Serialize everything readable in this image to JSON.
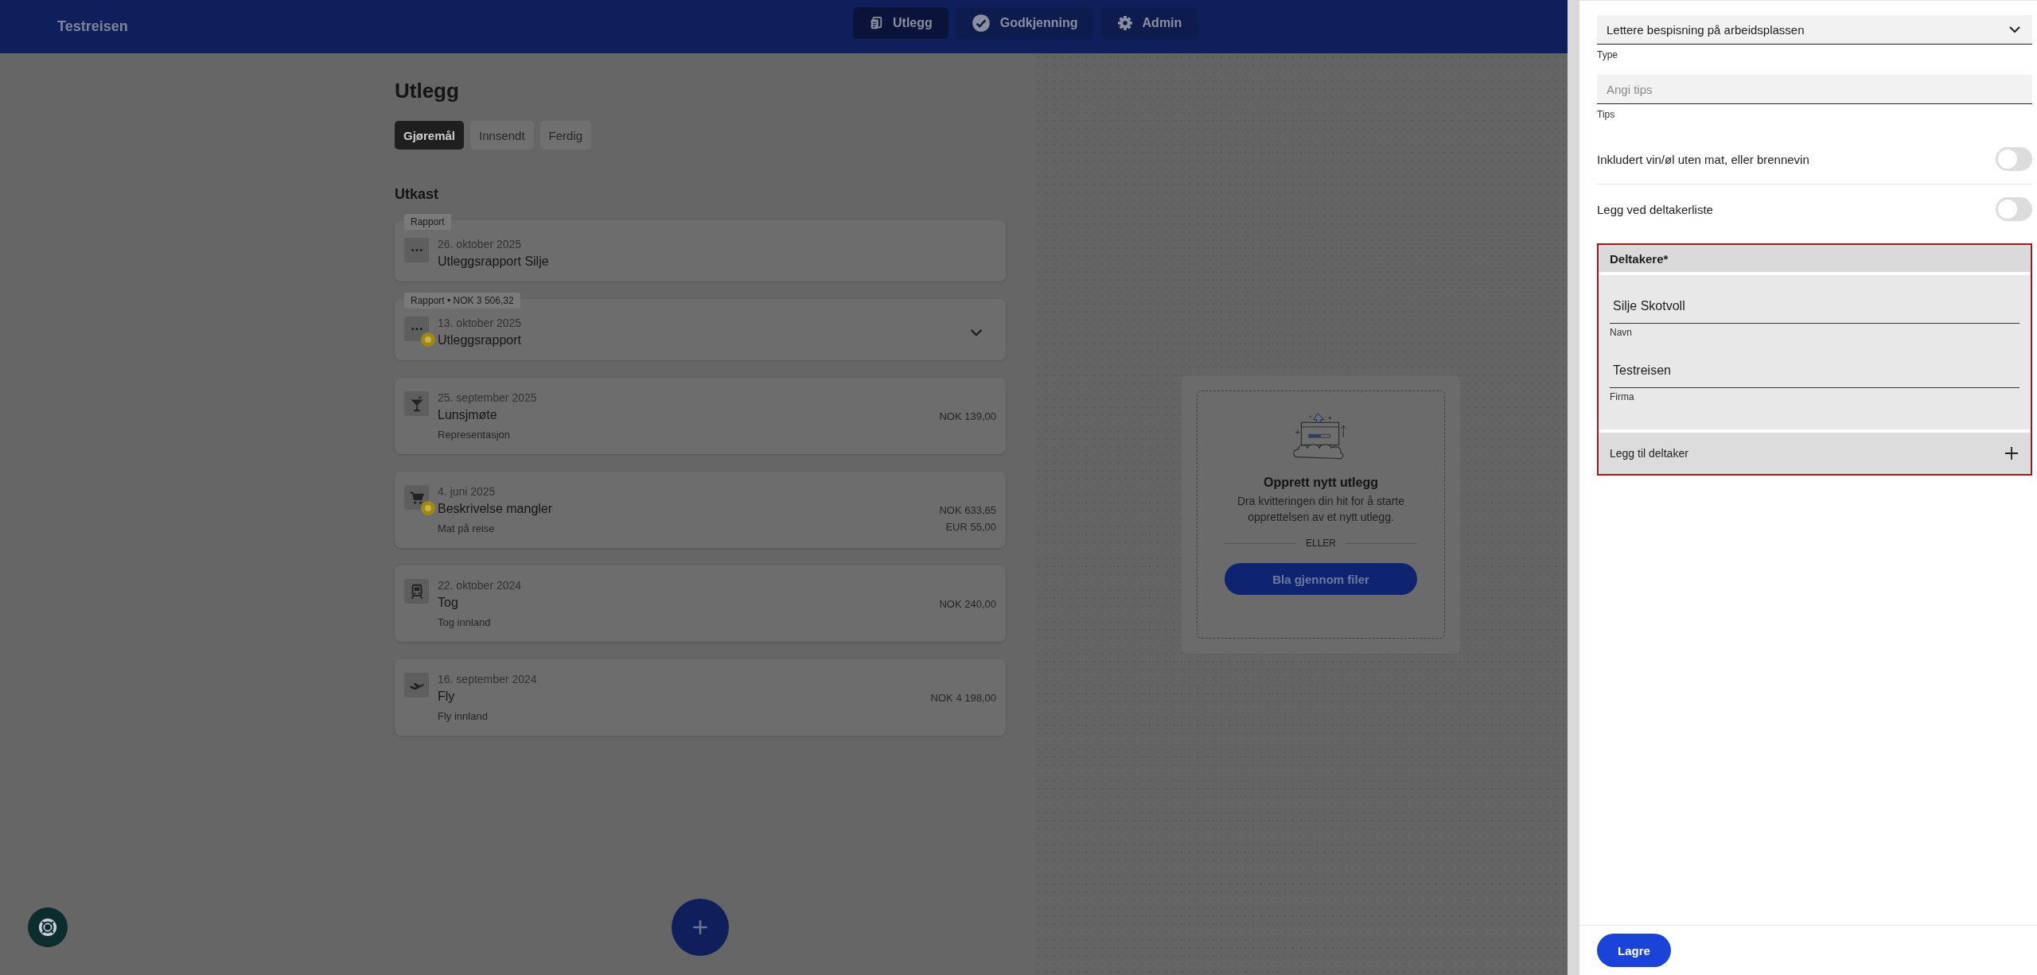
{
  "header": {
    "brand": "Testreisen",
    "nav": [
      {
        "label": "Utlegg",
        "selected": true
      },
      {
        "label": "Godkjenning",
        "selected": false
      },
      {
        "label": "Admin",
        "selected": false
      }
    ]
  },
  "page": {
    "title": "Utlegg",
    "tabs": [
      {
        "label": "Gjøremål",
        "selected": true
      },
      {
        "label": "Innsendt",
        "selected": false
      },
      {
        "label": "Ferdig",
        "selected": false
      }
    ],
    "section_title": "Utkast",
    "items": [
      {
        "kind": "report",
        "tag": "Rapport",
        "warning": false,
        "expandable": false,
        "date": "26. oktober 2025",
        "title": "Utleggsrapport Silje"
      },
      {
        "kind": "report",
        "tag": "Rapport • NOK 3 506,32",
        "warning": true,
        "expandable": true,
        "date": "13. oktober 2025",
        "title": "Utleggsrapport"
      },
      {
        "kind": "expense",
        "warning": false,
        "expandable": false,
        "date": "25. september 2025",
        "title": "Lunsjmøte",
        "subtitle": "Representasjon",
        "amounts": [
          "NOK 139,00"
        ]
      },
      {
        "kind": "expense",
        "warning": true,
        "expandable": false,
        "date": "4. juni 2025",
        "title": "Beskrivelse mangler",
        "subtitle": "Mat på reise",
        "amounts": [
          "NOK 633,65",
          "EUR 55,00"
        ]
      },
      {
        "kind": "expense",
        "warning": false,
        "expandable": false,
        "date": "22. oktober 2024",
        "title": "Tog",
        "subtitle": "Tog innland",
        "amounts": [
          "NOK 240,00"
        ]
      },
      {
        "kind": "expense",
        "warning": false,
        "expandable": false,
        "date": "16. september 2024",
        "title": "Fly",
        "subtitle": "Fly innland",
        "amounts": [
          "NOK 4 198,00"
        ]
      }
    ]
  },
  "dropzone": {
    "title": "Opprett nytt utlegg",
    "text": "Dra kvitteringen din hit for å starte opprettelsen av et nytt utlegg.",
    "divider": "ELLER",
    "button": "Bla gjennom filer"
  },
  "drawer": {
    "type_select": {
      "value": "Lettere bespisning på arbeidsplassen",
      "label": "Type"
    },
    "tips": {
      "placeholder": "Angi tips",
      "label": "Tips"
    },
    "toggles": [
      {
        "label": "Inkludert vin/øl uten mat, eller brennevin",
        "on": false
      },
      {
        "label": "Legg ved deltakerliste",
        "on": false
      }
    ],
    "participants": {
      "title": "Deltakere*",
      "fields": [
        {
          "value": "Silje Skotvoll",
          "label": "Navn"
        },
        {
          "value": "Testreisen",
          "label": "Firma"
        }
      ],
      "add_label": "Legg til deltaker"
    },
    "save": "Lagre"
  }
}
